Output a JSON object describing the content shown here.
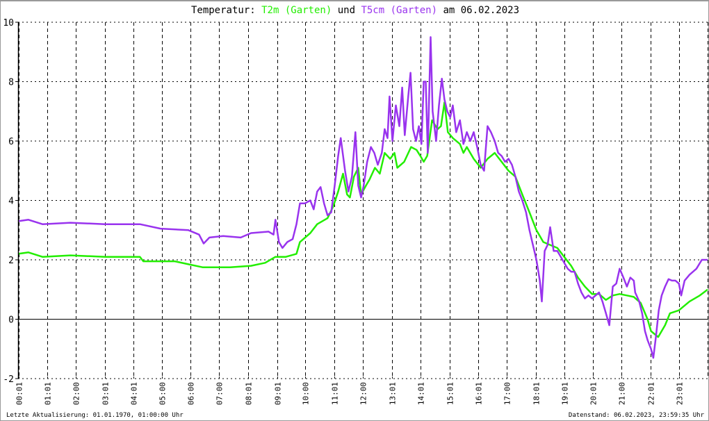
{
  "title": {
    "prefix": "Temperatur: ",
    "series1": "T2m (Garten)",
    "joiner": " und ",
    "series2": "T5cm (Garten)",
    "suffix": " am 06.02.2023"
  },
  "footer": {
    "left": "Letzte Aktualisierung: 01.01.1970, 01:00:00 Uhr",
    "right": "Datenstand: 06.02.2023, 23:59:35 Uhr"
  },
  "colors": {
    "t2m": "#22ee00",
    "t5cm": "#9933ee",
    "axis": "#000000"
  },
  "chart_data": {
    "type": "line",
    "title": "Temperatur: T2m (Garten) und T5cm (Garten) am 06.02.2023",
    "xlabel": "",
    "ylabel": "",
    "xlim": [
      0,
      24
    ],
    "ylim": [
      -2,
      10
    ],
    "yticks": [
      -2,
      0,
      2,
      4,
      6,
      8,
      10
    ],
    "xticks": [
      {
        "h": 0.02,
        "label": "00:01"
      },
      {
        "h": 1.02,
        "label": "01:01"
      },
      {
        "h": 2,
        "label": "02:00"
      },
      {
        "h": 3.02,
        "label": "03:01"
      },
      {
        "h": 4.02,
        "label": "04:01"
      },
      {
        "h": 5,
        "label": "05:00"
      },
      {
        "h": 6,
        "label": "06:00"
      },
      {
        "h": 7,
        "label": "07:00"
      },
      {
        "h": 8.02,
        "label": "08:01"
      },
      {
        "h": 9.02,
        "label": "09:01"
      },
      {
        "h": 10,
        "label": "10:00"
      },
      {
        "h": 11.02,
        "label": "11:01"
      },
      {
        "h": 12,
        "label": "12:00"
      },
      {
        "h": 13.02,
        "label": "13:01"
      },
      {
        "h": 14.02,
        "label": "14:01"
      },
      {
        "h": 15.02,
        "label": "15:01"
      },
      {
        "h": 16.02,
        "label": "16:01"
      },
      {
        "h": 17,
        "label": "17:00"
      },
      {
        "h": 18.02,
        "label": "18:01"
      },
      {
        "h": 19.02,
        "label": "19:01"
      },
      {
        "h": 20.02,
        "label": "20:01"
      },
      {
        "h": 21,
        "label": "21:00"
      },
      {
        "h": 22.02,
        "label": "22:01"
      },
      {
        "h": 23.02,
        "label": "23:01"
      }
    ],
    "grid": true,
    "series": [
      {
        "name": "T2m (Garten)",
        "color": "#22ee00",
        "points": [
          [
            0,
            2.2
          ],
          [
            0.36,
            2.25
          ],
          [
            0.85,
            2.1
          ],
          [
            1.82,
            2.15
          ],
          [
            3.03,
            2.1
          ],
          [
            4.24,
            2.1
          ],
          [
            4.36,
            1.95
          ],
          [
            5.45,
            1.95
          ],
          [
            5.93,
            1.85
          ],
          [
            6.42,
            1.75
          ],
          [
            7.38,
            1.75
          ],
          [
            8.11,
            1.8
          ],
          [
            8.6,
            1.9
          ],
          [
            8.96,
            2.1
          ],
          [
            9.32,
            2.1
          ],
          [
            9.69,
            2.2
          ],
          [
            9.81,
            2.6
          ],
          [
            10.17,
            2.9
          ],
          [
            10.41,
            3.2
          ],
          [
            10.77,
            3.4
          ],
          [
            10.97,
            3.8
          ],
          [
            11.14,
            4.3
          ],
          [
            11.31,
            4.9
          ],
          [
            11.45,
            4.2
          ],
          [
            11.55,
            4.1
          ],
          [
            11.69,
            4.8
          ],
          [
            11.84,
            5.1
          ],
          [
            11.94,
            4.2
          ],
          [
            12.11,
            4.5
          ],
          [
            12.23,
            4.7
          ],
          [
            12.42,
            5.1
          ],
          [
            12.59,
            4.9
          ],
          [
            12.76,
            5.6
          ],
          [
            12.95,
            5.4
          ],
          [
            13.1,
            5.6
          ],
          [
            13.2,
            5.1
          ],
          [
            13.44,
            5.3
          ],
          [
            13.68,
            5.8
          ],
          [
            13.87,
            5.7
          ],
          [
            14.0,
            5.5
          ],
          [
            14.12,
            5.3
          ],
          [
            14.24,
            5.5
          ],
          [
            14.41,
            6.7
          ],
          [
            14.6,
            6.4
          ],
          [
            14.72,
            6.5
          ],
          [
            14.84,
            7.3
          ],
          [
            14.96,
            6.3
          ],
          [
            15.13,
            6.1
          ],
          [
            15.38,
            5.9
          ],
          [
            15.5,
            5.6
          ],
          [
            15.62,
            5.8
          ],
          [
            15.86,
            5.4
          ],
          [
            16.1,
            5.1
          ],
          [
            16.34,
            5.4
          ],
          [
            16.59,
            5.6
          ],
          [
            16.83,
            5.3
          ],
          [
            17.07,
            5.0
          ],
          [
            17.31,
            4.8
          ],
          [
            17.55,
            4.2
          ],
          [
            17.8,
            3.6
          ],
          [
            18.04,
            3.0
          ],
          [
            18.28,
            2.6
          ],
          [
            18.52,
            2.5
          ],
          [
            18.77,
            2.4
          ],
          [
            19.01,
            2.1
          ],
          [
            19.25,
            1.8
          ],
          [
            19.49,
            1.4
          ],
          [
            19.73,
            1.1
          ],
          [
            19.98,
            0.85
          ],
          [
            20.22,
            0.85
          ],
          [
            20.46,
            0.65
          ],
          [
            20.7,
            0.8
          ],
          [
            20.94,
            0.85
          ],
          [
            21.19,
            0.8
          ],
          [
            21.43,
            0.75
          ],
          [
            21.67,
            0.55
          ],
          [
            21.91,
            0.0
          ],
          [
            22.03,
            -0.4
          ],
          [
            22.28,
            -0.6
          ],
          [
            22.52,
            -0.2
          ],
          [
            22.69,
            0.2
          ],
          [
            23.0,
            0.3
          ],
          [
            23.37,
            0.6
          ],
          [
            23.73,
            0.8
          ],
          [
            24,
            1.0
          ]
        ]
      },
      {
        "name": "T5cm (Garten)",
        "color": "#9933ee",
        "points": [
          [
            0,
            3.3
          ],
          [
            0.36,
            3.35
          ],
          [
            0.85,
            3.2
          ],
          [
            1.82,
            3.25
          ],
          [
            3.03,
            3.2
          ],
          [
            4.24,
            3.2
          ],
          [
            4.96,
            3.05
          ],
          [
            5.93,
            3.0
          ],
          [
            6.3,
            2.85
          ],
          [
            6.46,
            2.55
          ],
          [
            6.66,
            2.75
          ],
          [
            7.14,
            2.8
          ],
          [
            7.75,
            2.75
          ],
          [
            8.11,
            2.9
          ],
          [
            8.72,
            2.95
          ],
          [
            8.89,
            2.85
          ],
          [
            8.96,
            3.35
          ],
          [
            9.08,
            2.6
          ],
          [
            9.2,
            2.4
          ],
          [
            9.37,
            2.6
          ],
          [
            9.56,
            2.7
          ],
          [
            9.69,
            3.2
          ],
          [
            9.81,
            3.9
          ],
          [
            9.98,
            3.9
          ],
          [
            10.17,
            4.0
          ],
          [
            10.29,
            3.7
          ],
          [
            10.41,
            4.3
          ],
          [
            10.53,
            4.45
          ],
          [
            10.65,
            3.9
          ],
          [
            10.77,
            3.5
          ],
          [
            10.9,
            3.6
          ],
          [
            11.02,
            4.5
          ],
          [
            11.14,
            5.5
          ],
          [
            11.23,
            6.1
          ],
          [
            11.38,
            5.0
          ],
          [
            11.5,
            4.3
          ],
          [
            11.62,
            4.8
          ],
          [
            11.74,
            6.3
          ],
          [
            11.84,
            4.5
          ],
          [
            11.94,
            4.1
          ],
          [
            12.03,
            4.5
          ],
          [
            12.15,
            5.3
          ],
          [
            12.28,
            5.8
          ],
          [
            12.4,
            5.6
          ],
          [
            12.52,
            5.2
          ],
          [
            12.66,
            5.6
          ],
          [
            12.76,
            6.4
          ],
          [
            12.86,
            6.1
          ],
          [
            12.93,
            7.5
          ],
          [
            13.03,
            6.0
          ],
          [
            13.15,
            7.2
          ],
          [
            13.27,
            6.5
          ],
          [
            13.37,
            7.8
          ],
          [
            13.46,
            6.2
          ],
          [
            13.58,
            7.5
          ],
          [
            13.66,
            8.3
          ],
          [
            13.75,
            6.4
          ],
          [
            13.85,
            6.0
          ],
          [
            13.95,
            6.5
          ],
          [
            14.04,
            5.9
          ],
          [
            14.12,
            8.0
          ],
          [
            14.19,
            8.0
          ],
          [
            14.26,
            5.6
          ],
          [
            14.36,
            9.5
          ],
          [
            14.43,
            7.0
          ],
          [
            14.55,
            6.0
          ],
          [
            14.65,
            7.2
          ],
          [
            14.75,
            8.1
          ],
          [
            14.84,
            7.4
          ],
          [
            14.94,
            7.0
          ],
          [
            15.04,
            6.8
          ],
          [
            15.13,
            7.2
          ],
          [
            15.25,
            6.3
          ],
          [
            15.38,
            6.7
          ],
          [
            15.5,
            5.9
          ],
          [
            15.62,
            6.3
          ],
          [
            15.74,
            6.0
          ],
          [
            15.86,
            6.3
          ],
          [
            15.98,
            5.8
          ],
          [
            16.1,
            5.2
          ],
          [
            16.22,
            5.0
          ],
          [
            16.34,
            6.5
          ],
          [
            16.46,
            6.3
          ],
          [
            16.59,
            6.0
          ],
          [
            16.71,
            5.6
          ],
          [
            16.83,
            5.5
          ],
          [
            16.95,
            5.3
          ],
          [
            17.07,
            5.4
          ],
          [
            17.19,
            5.2
          ],
          [
            17.31,
            4.8
          ],
          [
            17.43,
            4.3
          ],
          [
            17.55,
            4.0
          ],
          [
            17.68,
            3.6
          ],
          [
            17.8,
            3.0
          ],
          [
            17.92,
            2.5
          ],
          [
            18.04,
            2.0
          ],
          [
            18.16,
            1.3
          ],
          [
            18.23,
            0.6
          ],
          [
            18.33,
            2.3
          ],
          [
            18.43,
            2.5
          ],
          [
            18.52,
            3.1
          ],
          [
            18.64,
            2.3
          ],
          [
            18.77,
            2.3
          ],
          [
            18.89,
            2.1
          ],
          [
            19.01,
            1.9
          ],
          [
            19.13,
            1.7
          ],
          [
            19.25,
            1.6
          ],
          [
            19.37,
            1.6
          ],
          [
            19.49,
            1.2
          ],
          [
            19.61,
            0.9
          ],
          [
            19.73,
            0.7
          ],
          [
            19.85,
            0.8
          ],
          [
            19.98,
            0.7
          ],
          [
            20.1,
            0.8
          ],
          [
            20.22,
            0.9
          ],
          [
            20.34,
            0.6
          ],
          [
            20.46,
            0.2
          ],
          [
            20.58,
            -0.2
          ],
          [
            20.7,
            1.1
          ],
          [
            20.82,
            1.2
          ],
          [
            20.94,
            1.7
          ],
          [
            21.07,
            1.4
          ],
          [
            21.19,
            1.1
          ],
          [
            21.31,
            1.4
          ],
          [
            21.43,
            1.3
          ],
          [
            21.48,
            0.9
          ],
          [
            21.62,
            0.6
          ],
          [
            21.72,
            0.2
          ],
          [
            21.82,
            -0.4
          ],
          [
            21.91,
            -0.7
          ],
          [
            22.03,
            -1.0
          ],
          [
            22.11,
            -1.3
          ],
          [
            22.2,
            -0.6
          ],
          [
            22.3,
            0.3
          ],
          [
            22.4,
            0.8
          ],
          [
            22.52,
            1.1
          ],
          [
            22.64,
            1.35
          ],
          [
            22.76,
            1.3
          ],
          [
            22.88,
            1.3
          ],
          [
            23.0,
            1.2
          ],
          [
            23.08,
            0.8
          ],
          [
            23.2,
            1.3
          ],
          [
            23.37,
            1.5
          ],
          [
            23.61,
            1.7
          ],
          [
            23.8,
            2.0
          ],
          [
            24,
            2.0
          ]
        ]
      }
    ]
  }
}
